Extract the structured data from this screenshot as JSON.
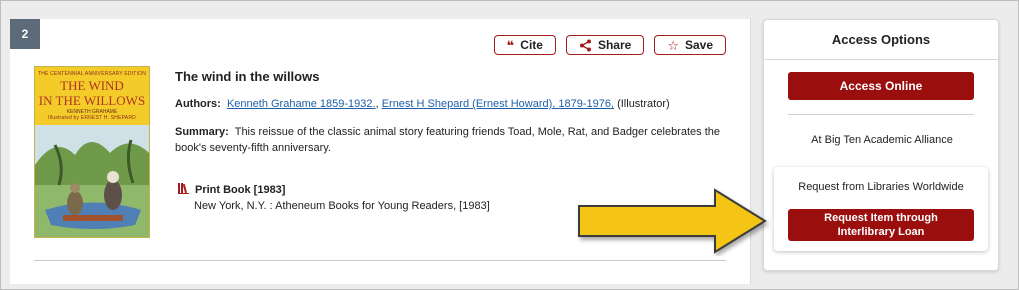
{
  "result": {
    "index": "2",
    "actions": {
      "cite_label": "Cite",
      "share_label": "Share",
      "save_label": "Save"
    },
    "cover": {
      "edition_line": "THE CENTENNIAL ANNIVERSARY EDITION",
      "title_line1": "THE WIND",
      "title_line2": "IN THE WILLOWS",
      "author_line": "KENNETH GRAHAME",
      "illustrator_line": "Illustrated by ERNEST H. SHEPARD"
    },
    "title": "The wind in the willows",
    "authors_label": "Authors:",
    "author1": "Kenneth Grahame 1859-1932.",
    "author_sep": ", ",
    "author2": "Ernest H Shepard (Ernest Howard), 1879-1976,",
    "author2_role": " (Illustrator)",
    "summary_label": "Summary:",
    "summary_text": "This reissue of the classic animal story featuring friends Toad, Mole, Rat, and Badger celebrates the book's seventy-fifth anniversary.",
    "format_label": "Print Book [1983]",
    "publisher": "New York, N.Y. : Atheneum Books for Young Readers, [1983]"
  },
  "access": {
    "title": "Access Options",
    "online_label": "Access Online",
    "alliance_text": "At Big Ten Academic Alliance",
    "worldwide_text": "Request from Libraries Worldwide",
    "ill_label": "Request Item through Interlibrary Loan"
  },
  "colors": {
    "brand_red": "#9b0e0e",
    "arrow_fill": "#f5c518",
    "badge_bg": "#5c6a79",
    "link": "#1f5fa8"
  }
}
